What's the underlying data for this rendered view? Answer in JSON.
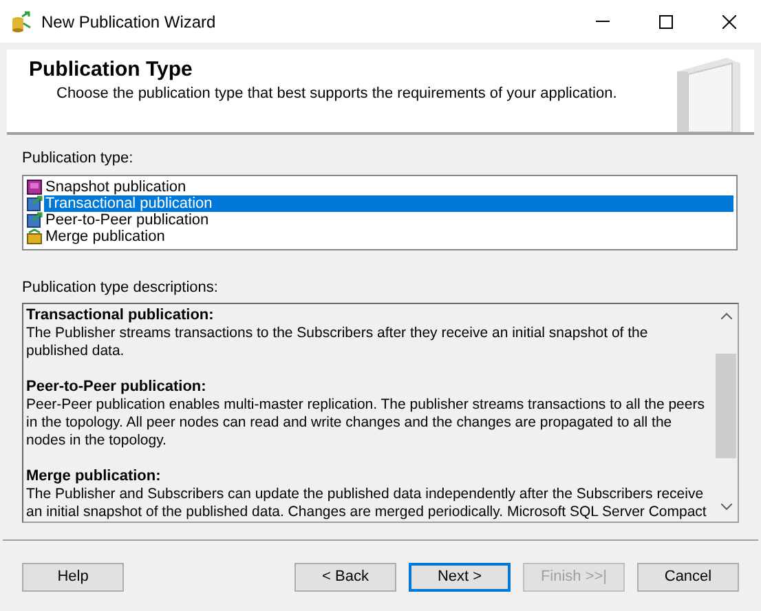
{
  "window": {
    "title": "New Publication Wizard"
  },
  "header": {
    "title": "Publication Type",
    "subtitle": "Choose the publication type that best supports the requirements of your application."
  },
  "type_list": {
    "label": "Publication type:",
    "items": [
      {
        "label": "Snapshot publication",
        "kind": "snapshot",
        "selected": false
      },
      {
        "label": "Transactional publication",
        "kind": "transactional",
        "selected": true
      },
      {
        "label": "Peer-to-Peer publication",
        "kind": "transactional",
        "selected": false
      },
      {
        "label": "Merge publication",
        "kind": "merge",
        "selected": false
      }
    ]
  },
  "descriptions": {
    "label": "Publication type descriptions:",
    "sections": [
      {
        "heading": "Transactional publication:",
        "text": "The Publisher streams transactions to the Subscribers after they receive an initial snapshot of the published data."
      },
      {
        "heading": "Peer-to-Peer publication:",
        "text": "Peer-Peer publication enables multi-master replication. The publisher streams transactions to all the peers in the topology. All peer nodes can read and write changes and the changes are propagated to all the nodes in the topology."
      },
      {
        "heading": "Merge publication:",
        "text": "The Publisher and Subscribers can update the published data independently after the Subscribers receive an initial snapshot of the published data. Changes are merged periodically. Microsoft SQL Server Compact"
      }
    ]
  },
  "buttons": [
    {
      "label": "Help",
      "disabled": false,
      "default": false
    },
    {
      "label": "< Back",
      "disabled": false,
      "default": false
    },
    {
      "label": "Next >",
      "disabled": false,
      "default": true
    },
    {
      "label": "Finish >>|",
      "disabled": true,
      "default": false
    },
    {
      "label": "Cancel",
      "disabled": false,
      "default": false
    }
  ]
}
